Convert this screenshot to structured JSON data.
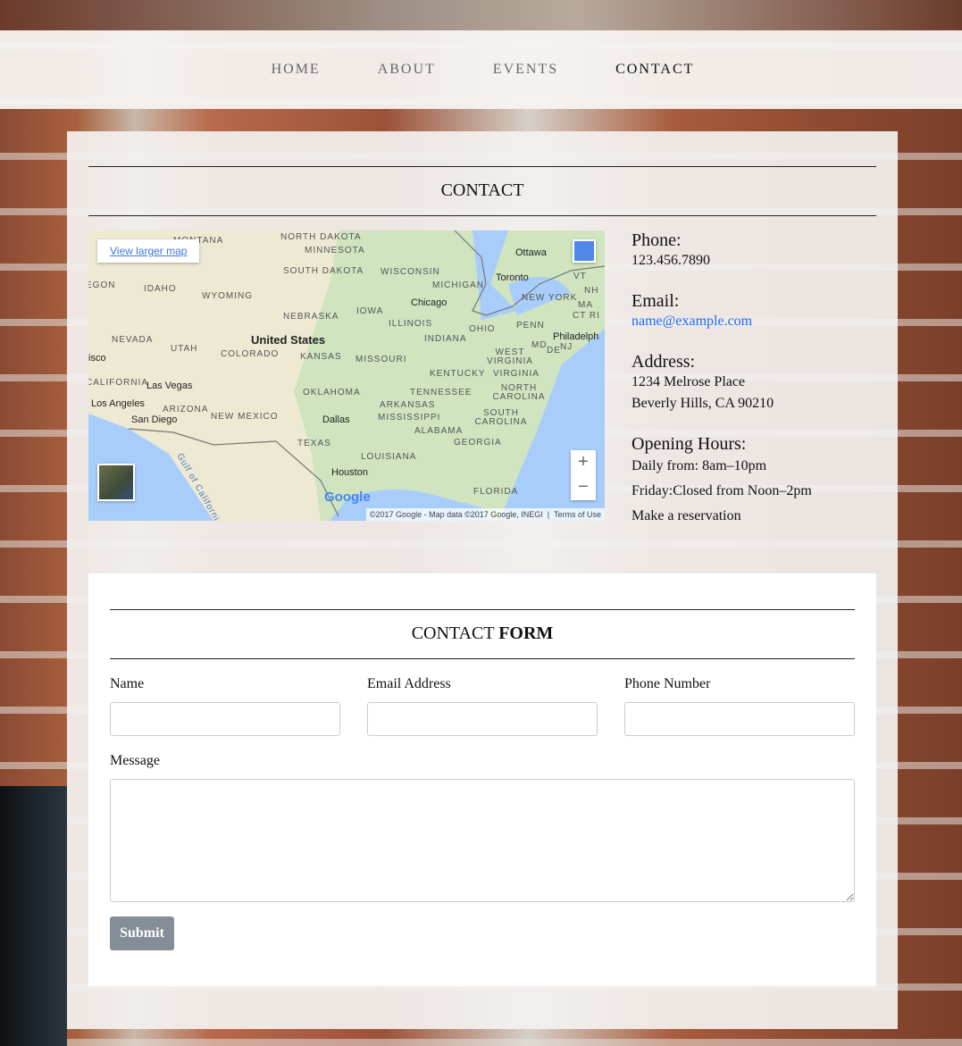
{
  "nav": {
    "items": [
      "HOME",
      "ABOUT",
      "EVENTS",
      "CONTACT"
    ],
    "active": "CONTACT"
  },
  "contact": {
    "title": "CONTACT"
  },
  "map": {
    "view_larger": "View larger map",
    "logo": "Google",
    "attribution": "©2017 Google - Map data ©2017 Google, INEGI",
    "terms": "Terms of Use",
    "zoom_in": "+",
    "zoom_out": "−",
    "states": [
      "MONTANA",
      "NORTH DAKOTA",
      "MINNESOTA",
      "SOUTH DAKOTA",
      "WISCONSIN",
      "MICHIGAN",
      "OREGON",
      "IDAHO",
      "WYOMING",
      "NEBRASKA",
      "IOWA",
      "ILLINOIS",
      "INDIANA",
      "OHIO",
      "PENN",
      "NEW YORK",
      "VT",
      "NH",
      "MA",
      "CT RI",
      "NEVADA",
      "UTAH",
      "COLORADO",
      "KANSAS",
      "MISSOURI",
      "WEST VIRGINIA",
      "VIRGINIA",
      "KENTUCKY",
      "MD",
      "DE",
      "NJ",
      "CALIFORNIA",
      "OKLAHOMA",
      "TENNESSEE",
      "NORTH CAROLINA",
      "ARKANSAS",
      "ARIZONA",
      "NEW MEXICO",
      "MISSISSIPPI",
      "SOUTH CAROLINA",
      "ALABAMA",
      "GEORGIA",
      "TEXAS",
      "LOUISIANA",
      "FLORIDA",
      "Gulf of California"
    ],
    "cities": [
      "Ottawa",
      "Toronto",
      "Chicago",
      "Philadelph",
      "Las Vegas",
      "Los Angeles",
      "San Diego",
      "Dallas",
      "Houston",
      "isco"
    ],
    "country": "United States"
  },
  "info": {
    "phone_label": "Phone:",
    "phone": "123.456.7890",
    "email_label": "Email:",
    "email": "name@example.com",
    "address_label": "Address:",
    "address1": "1234 Melrose Place",
    "address2": "Beverly Hills, CA 90210",
    "hours_label": "Opening Hours:",
    "hours1": "Daily from: 8am–10pm",
    "hours2": "Friday:Closed from Noon–2pm",
    "reservation": "Make a reservation"
  },
  "form": {
    "title_plain": "CONTACT ",
    "title_bold": "FORM",
    "name_label": "Name",
    "email_label": "Email Address",
    "phone_label": "Phone Number",
    "message_label": "Message",
    "submit": "Submit"
  }
}
